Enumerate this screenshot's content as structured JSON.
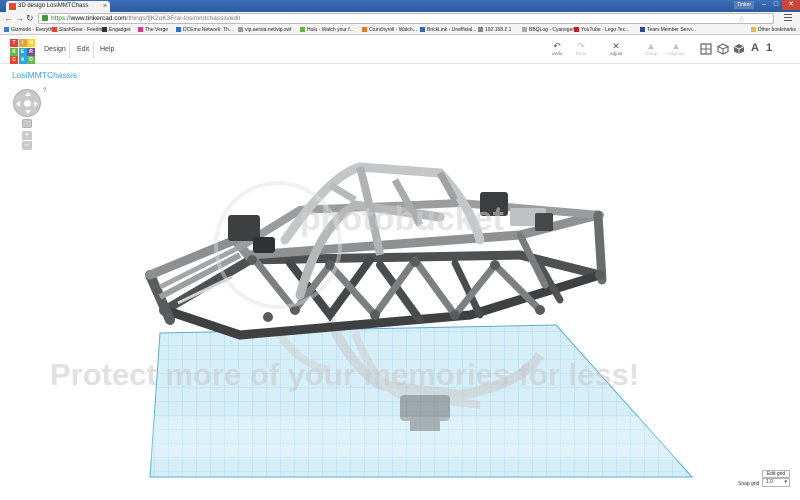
{
  "browser": {
    "tab_title": "3D design LosiMMTChass",
    "user_badge": "Tinker",
    "url_scheme": "https://",
    "url_host": "www.tinkercad.com",
    "url_path": "/things/fjK2oK3FraI-losimmtchassis/edit"
  },
  "bookmarks": [
    {
      "label": "Gizmodo - Everythin...",
      "color": "#3b7dc6"
    },
    {
      "label": "SlashGear - Feeding...",
      "color": "#e2432a"
    },
    {
      "label": "Engadget",
      "color": "#333333"
    },
    {
      "label": "The Verge",
      "color": "#e4387a"
    },
    {
      "label": "DCEmu Network: Th...",
      "color": "#2a6fc9"
    },
    {
      "label": "vip.aersia.net/vip.swf",
      "color": "#999999"
    },
    {
      "label": "Hulu - Watch your f...",
      "color": "#6cb33f"
    },
    {
      "label": "Crunchyroll - Watch...",
      "color": "#f47521"
    },
    {
      "label": "BrickLink - Unofficial...",
      "color": "#2f64b2"
    },
    {
      "label": "192.168.2.1",
      "color": "#888888"
    },
    {
      "label": "BBQLog - Cyanogen...",
      "color": "#aaaaaa"
    },
    {
      "label": "YouTube - Lego Tec...",
      "color": "#cc181e"
    },
    {
      "label": "Team Member Servi...",
      "color": "#2b4d8f"
    }
  ],
  "bookmarks_other": "Other bookmarks",
  "app": {
    "logo_letters": [
      "T",
      "I",
      "N",
      "K",
      "E",
      "R",
      "C",
      "A",
      "D"
    ],
    "logo_colors": [
      "#e8422f",
      "#f0a12c",
      "#f9d22e",
      "#66b945",
      "#2ba7df",
      "#7a4fa0",
      "#e8422f",
      "#2ba7df",
      "#66b945"
    ],
    "menu": [
      "Design",
      "Edit",
      "Help"
    ],
    "tools": [
      {
        "icon": "↶",
        "label": "Undo",
        "enabled": true
      },
      {
        "icon": "↷",
        "label": "Redo",
        "enabled": false
      },
      {
        "icon": "✕",
        "label": "Adjust",
        "enabled": true
      },
      {
        "icon": "▲",
        "label": "Group",
        "enabled": false
      },
      {
        "icon": "▲",
        "label": "Ungroup",
        "enabled": false
      }
    ],
    "view_labels": [
      "A",
      "1"
    ],
    "design_title": "LosiMMTChassis",
    "help_label": "?"
  },
  "grid_controls": {
    "edit_grid": "Edit grid",
    "snap_label": "Snap grid",
    "snap_value": "1.0"
  },
  "watermark": {
    "logo": "photobucket",
    "tagline": "Protect more of your memories for less!"
  }
}
